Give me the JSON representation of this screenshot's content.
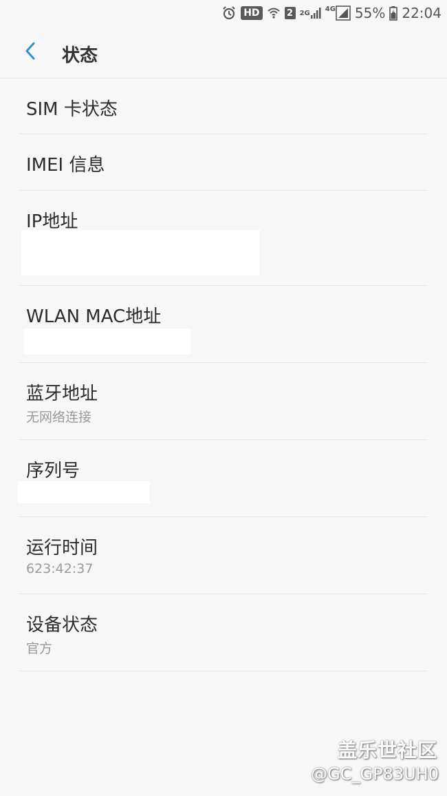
{
  "status_bar": {
    "icons": [
      "alarm-icon",
      "wifi-icon",
      "signal-2g-icon",
      "signal-4g-icon"
    ],
    "hd_label": "HD",
    "sim_slot": "2",
    "label_2g": "2G",
    "label_4g": "4G",
    "battery": "55%",
    "time": "22:04"
  },
  "app_bar": {
    "title": "状态",
    "back_icon": "chevron-left-icon",
    "accent": "#3a8ec8"
  },
  "items": [
    {
      "title": "SIM 卡状态"
    },
    {
      "title": "IMEI 信息"
    },
    {
      "title": "IP地址",
      "value": ""
    },
    {
      "title": "WLAN MAC地址",
      "value": ""
    },
    {
      "title": "蓝牙地址",
      "subtitle": "无网络连接"
    },
    {
      "title": "序列号",
      "value": ""
    },
    {
      "title": "运行时间",
      "subtitle": "623:42:37"
    },
    {
      "title": "设备状态",
      "subtitle": "官方"
    }
  ],
  "watermark": {
    "site": "盖乐世社区",
    "user": "@GC_GP83UH0"
  }
}
